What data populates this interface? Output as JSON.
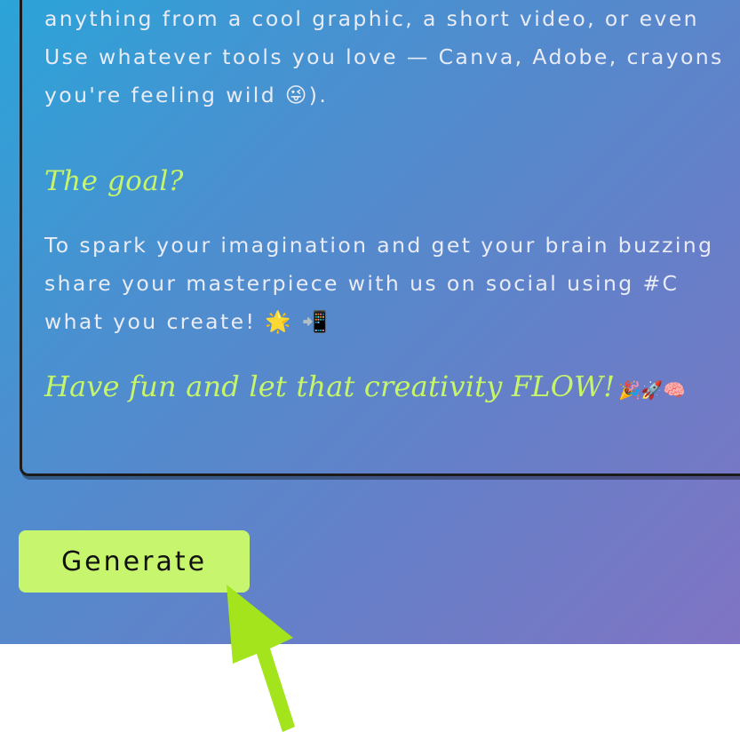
{
  "card": {
    "lines_top": [
      "anything from a cool graphic, a short video, or even",
      "Use whatever tools you love — Canva, Adobe, crayons",
      "you're feeling wild 😜)."
    ],
    "goal_heading": "The goal?",
    "lines_goal": [
      "To spark your imagination and get your brain buzzing",
      "share your masterpiece with us on social using #C",
      "what you create! 🌟 📲"
    ],
    "closing": "Have fun and let that creativity FLOW!",
    "closing_emojis": "🎉🚀🧠"
  },
  "generate_button": {
    "label": "Generate"
  },
  "colors": {
    "accent": "#c7f56e",
    "arrow": "#a3e41c"
  }
}
